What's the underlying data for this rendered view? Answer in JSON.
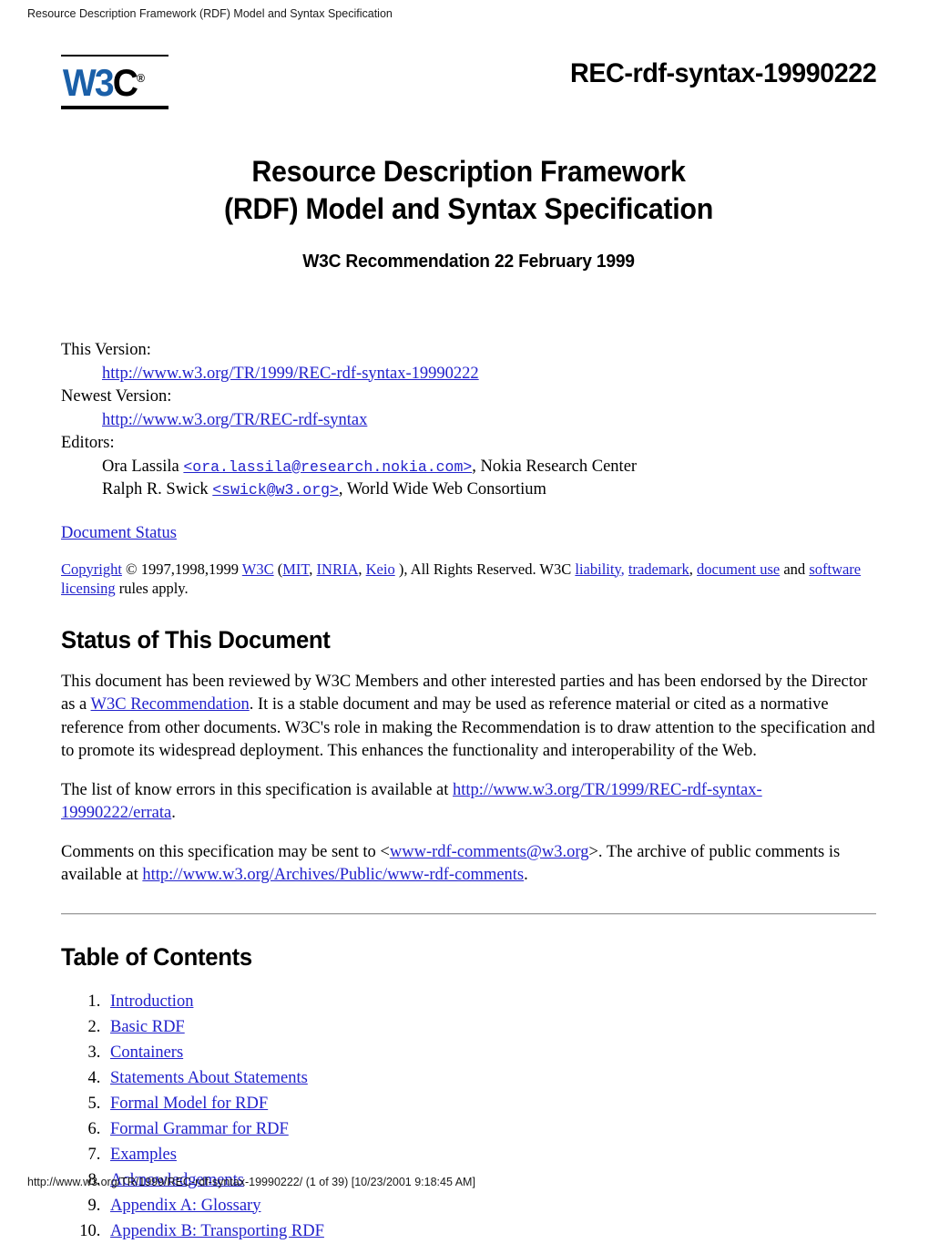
{
  "browser": {
    "running_head": "Resource Description Framework (RDF) Model and Syntax Specification",
    "running_foot": "http://www.w3.org/TR/1999/REC-rdf-syntax-19990222/ (1 of 39) [10/23/2001 9:18:45 AM]"
  },
  "colors": {
    "link": "#2222cc",
    "logo_blue": "#1a5fa8",
    "text": "#000000",
    "rule": "#9a9a9a"
  },
  "masthead": {
    "logo_w3": "W3",
    "logo_c": "C",
    "logo_registered": "®",
    "version_id": "REC-rdf-syntax-19990222"
  },
  "title": {
    "line1": "Resource Description Framework",
    "line2": "(RDF) Model and Syntax Specification",
    "subtitle": "W3C Recommendation 22 February 1999"
  },
  "meta": {
    "this_version_label": "This Version:",
    "this_version_url": "http://www.w3.org/TR/1999/REC-rdf-syntax-19990222",
    "newest_version_label": "Newest Version:",
    "newest_version_url": "http://www.w3.org/TR/REC-rdf-syntax",
    "editors_label": "Editors:",
    "editor1_name": "Ora Lassila ",
    "editor1_email": "<ora.lassila@research.nokia.com>",
    "editor1_affiliation": ", Nokia Research Center",
    "editor2_name": "Ralph R. Swick ",
    "editor2_email": "<swick@w3.org>",
    "editor2_affiliation": ", World Wide Web Consortium",
    "document_status_link": "Document Status"
  },
  "copyright": {
    "copyright_link": "Copyright",
    "years": " © 1997,1998,1999 ",
    "w3c_link": "W3C",
    "open_paren": " (",
    "mit_link": "MIT",
    "comma1": ", ",
    "inria_link": "INRIA",
    "comma2": ", ",
    "keio_link": "Keio",
    "close_paren": " ), All Rights Reserved. W3C ",
    "liability_link": "liability,",
    "space1": " ",
    "trademark_link": "trademark",
    "comma3": ", ",
    "document_use_link": "document use",
    "and_text": " and ",
    "software_licensing_link": "software licensing",
    "tail": " rules apply."
  },
  "status": {
    "heading": "Status of This Document",
    "p1_a": "This document has been reviewed by W3C Members and other interested parties and has been endorsed by the Director as a ",
    "p1_link": "W3C Recommendation",
    "p1_b": ". It is a stable document and may be used as reference material or cited as a normative reference from other documents. W3C's role in making the Recommendation is to draw attention to the specification and to promote its widespread deployment. This enhances the functionality and interoperability of the Web.",
    "p2_a": "The list of know errors in this specification is available at ",
    "p2_link": "http://www.w3.org/TR/1999/REC-rdf-syntax-19990222/errata",
    "p2_b": ".",
    "p3_a": "Comments on this specification may be sent to <",
    "p3_link1": "www-rdf-comments@w3.org",
    "p3_b": ">. The archive of public comments is available at ",
    "p3_link2": "http://www.w3.org/Archives/Public/www-rdf-comments",
    "p3_c": "."
  },
  "toc": {
    "heading": "Table of Contents",
    "items": [
      "Introduction",
      "Basic RDF",
      "Containers",
      "Statements About Statements",
      "Formal Model for RDF",
      "Formal Grammar for RDF",
      "Examples",
      "Acknowledgements",
      "Appendix A: Glossary",
      "Appendix B: Transporting RDF"
    ]
  }
}
